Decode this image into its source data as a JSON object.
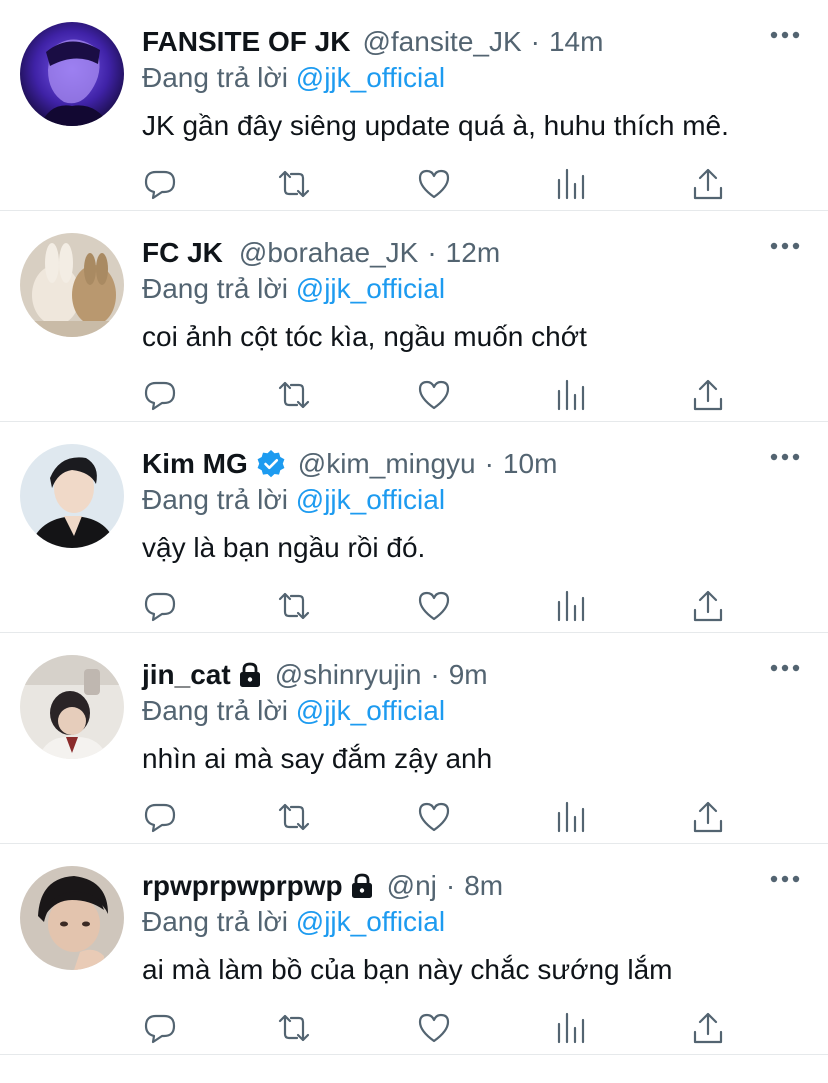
{
  "reply_prefix": "Đang trả lời",
  "colors": {
    "link": "#1d9bf0",
    "secondary_text": "#536471",
    "primary_text": "#0f1419",
    "verified_badge": "#1d9bf0",
    "divider": "#e6e9eb"
  },
  "icons": {
    "reply": "reply-icon",
    "retweet": "retweet-icon",
    "like": "heart-icon",
    "stats": "bar-chart-icon",
    "share": "share-icon",
    "more": "more-icon",
    "verified": "verified-badge-icon",
    "protected": "lock-icon"
  },
  "tweets": [
    {
      "name": "FANSITE OF JK",
      "handle": "@fansite_JK",
      "separator": "·",
      "time": "14m",
      "reply_to": "@jjk_official",
      "text": "JK gần đây siêng update quá à, huhu thích mê.",
      "verified": false,
      "protected": false
    },
    {
      "name": "FC JK",
      "handle": "@borahae_JK",
      "separator": "·",
      "time": "12m",
      "reply_to": "@jjk_official",
      "text": "coi ảnh cột tóc kìa, ngầu muốn chớt",
      "verified": false,
      "protected": false
    },
    {
      "name": "Kim MG",
      "handle": "@kim_mingyu",
      "separator": "·",
      "time": "10m",
      "reply_to": "@jjk_official",
      "text": "vậy là bạn ngầu rồi đó.",
      "verified": true,
      "protected": false
    },
    {
      "name": "jin_cat",
      "handle": "@shinryujin",
      "separator": "·",
      "time": "9m",
      "reply_to": "@jjk_official",
      "text": "nhìn ai mà say đắm zậy anh",
      "verified": false,
      "protected": true
    },
    {
      "name": "rpwprpwprpwp",
      "handle": "@nj",
      "separator": "·",
      "time": "8m",
      "reply_to": "@jjk_official",
      "text": "ai mà làm bồ của bạn này chắc sướng lắm",
      "verified": false,
      "protected": true
    }
  ]
}
